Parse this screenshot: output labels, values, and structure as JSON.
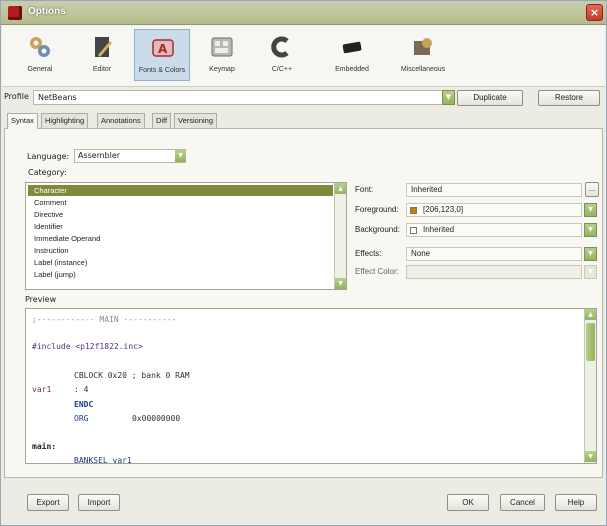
{
  "window": {
    "title": "Options",
    "close_glyph": "×"
  },
  "toolbar": {
    "items": [
      {
        "label": "General",
        "icon": "general-icon"
      },
      {
        "label": "Editor",
        "icon": "editor-icon"
      },
      {
        "label": "Fonts & Colors",
        "icon": "fonts-colors-icon",
        "selected": true
      },
      {
        "label": "Keymap",
        "icon": "keymap-icon"
      },
      {
        "label": "C/C++",
        "icon": "c-cpp-icon"
      },
      {
        "label": "Embedded",
        "icon": "embedded-icon"
      },
      {
        "label": "Miscellaneous",
        "icon": "miscellaneous-icon"
      }
    ]
  },
  "profile": {
    "label": "Profile",
    "value": "NetBeans",
    "duplicate_label": "Duplicate",
    "restore_label": "Restore"
  },
  "tabs": [
    {
      "label": "Syntax",
      "active": true
    },
    {
      "label": "Highlighting"
    },
    {
      "label": "Annotations"
    },
    {
      "label": "Diff"
    },
    {
      "label": "Versioning"
    }
  ],
  "language": {
    "label": "Language:",
    "value": "Assembler"
  },
  "category": {
    "label": "Category:",
    "items": [
      "Character",
      "Comment",
      "Directive",
      "Identifier",
      "Immediate Operand",
      "Instruction",
      "Label (instance)",
      "Label (jump)"
    ],
    "selected_index": 0
  },
  "properties": {
    "font_label": "Font:",
    "font_value": "Inherited",
    "font_button": "...",
    "foreground_label": "Foreground:",
    "foreground_value": "[206,123,0]",
    "foreground_color": "#ce7b00",
    "background_label": "Background:",
    "background_value": "Inherited",
    "effects_label": "Effects:",
    "effects_value": "None",
    "effect_color_label": "Effect Color:"
  },
  "preview": {
    "label": "Preview",
    "lines": [
      {
        "text": ";------------ MAIN -----------",
        "color": "#8c8c8c",
        "bold": false
      },
      {
        "text": "#include <p12f1822.inc>",
        "color": "#5a2d86",
        "bold": false
      },
      {
        "text": "CBLOCK 0x20 ; bank 0 RAM",
        "color": "#333333",
        "bold": false
      },
      {
        "text": "var1",
        "color": "#7b2f57",
        "bold": false
      },
      {
        "text": ": 4",
        "color": "#333333",
        "bold": false
      },
      {
        "text": "ENDC",
        "color": "#1d3b8c",
        "bold": true
      },
      {
        "text": "ORG",
        "color": "#1d3b8c",
        "bold": false
      },
      {
        "text": "0x00000000",
        "color": "#333333",
        "bold": false
      },
      {
        "text": "main:",
        "color": "#222222",
        "bold": true
      },
      {
        "text": "BANKSEL var1",
        "color": "#1d3b8c",
        "bold": false
      }
    ]
  },
  "buttons": {
    "export": "Export",
    "import": "Import",
    "ok": "OK",
    "cancel": "Cancel",
    "help": "Help"
  },
  "colors": {
    "selection_green": "#808a3a",
    "accent_green": "#94b262"
  }
}
